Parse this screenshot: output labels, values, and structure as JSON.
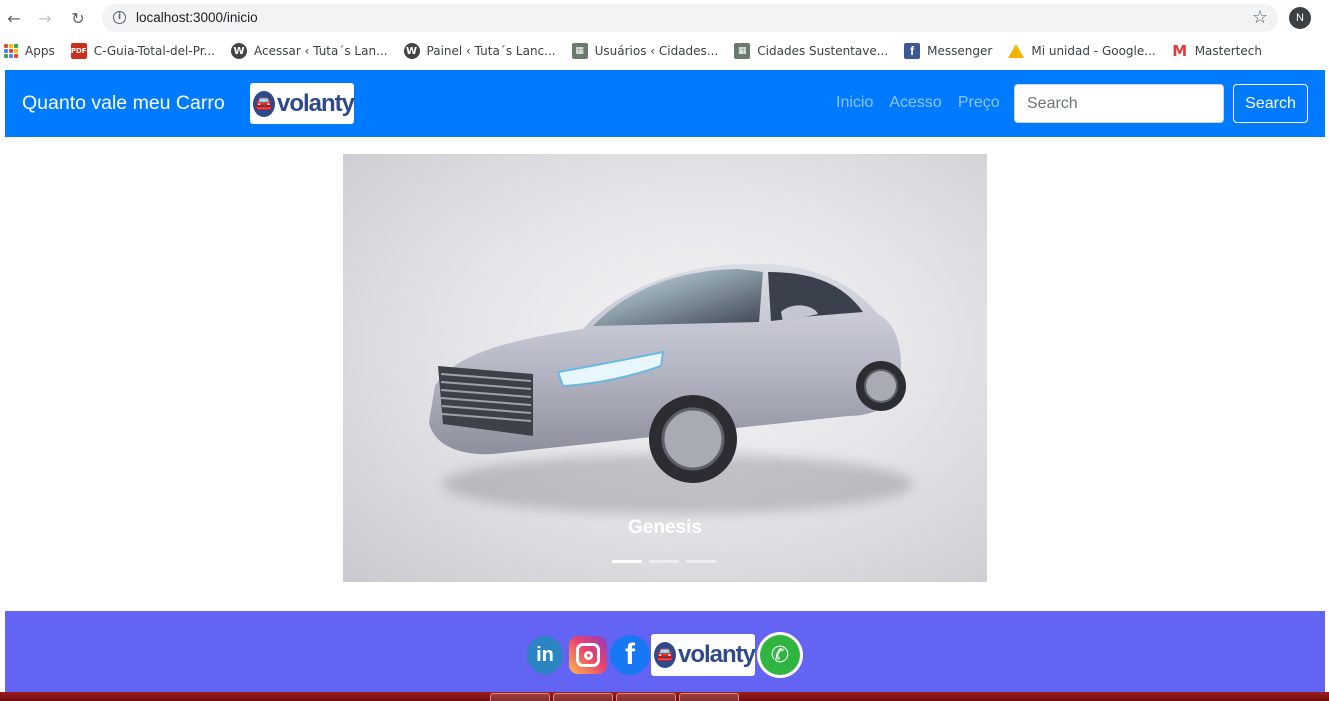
{
  "browser": {
    "url": "localhost:3000/inicio",
    "profile_initial": "N",
    "bookmarks": [
      {
        "label": "Apps",
        "icon": "apps-grid-icon"
      },
      {
        "label": "C-Guia-Total-del-Pr...",
        "icon": "pdf-icon"
      },
      {
        "label": "Acessar ‹ Tuta´s Lan...",
        "icon": "wordpress-icon"
      },
      {
        "label": "Painel ‹ Tuta´s Lanc...",
        "icon": "wordpress-icon"
      },
      {
        "label": "Usuários ‹ Cidades...",
        "icon": "city-icon"
      },
      {
        "label": "Cidades Sustentave...",
        "icon": "city-icon"
      },
      {
        "label": "Messenger",
        "icon": "facebook-icon"
      },
      {
        "label": "Mi unidad - Google...",
        "icon": "google-drive-icon"
      },
      {
        "label": "Mastertech",
        "icon": "mastertech-icon"
      }
    ]
  },
  "navbar": {
    "brand": "Quanto vale meu Carro",
    "logo_text": "volanty",
    "links": [
      "Inicio",
      "Acesso",
      "Preço"
    ],
    "search_placeholder": "Search",
    "search_button": "Search",
    "color": "#007bff"
  },
  "carousel": {
    "caption": "Genesis",
    "slide_count": 3,
    "active_index": 0
  },
  "footer": {
    "color": "#6363f4",
    "social": [
      {
        "name": "linkedin",
        "glyph": "in"
      },
      {
        "name": "instagram"
      },
      {
        "name": "facebook",
        "glyph": "f"
      },
      {
        "name": "volanty",
        "glyph": "volanty"
      },
      {
        "name": "whatsapp",
        "glyph": "✆"
      }
    ]
  }
}
